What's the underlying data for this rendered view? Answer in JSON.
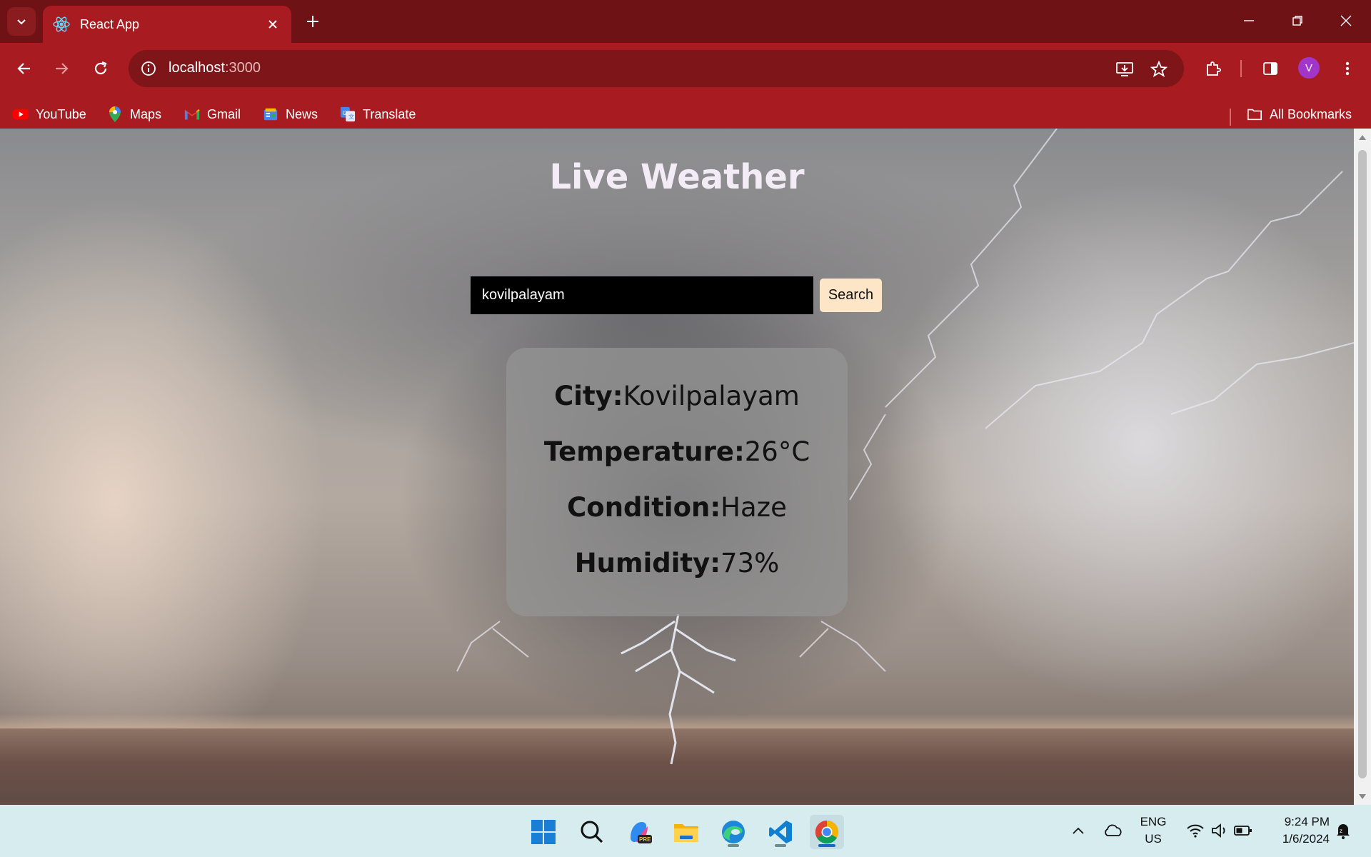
{
  "browser": {
    "tab_title": "React App",
    "url_host": "localhost",
    "url_port": ":3000",
    "avatar_letter": "V",
    "bookmarks": [
      {
        "label": "YouTube",
        "icon": "youtube-icon"
      },
      {
        "label": "Maps",
        "icon": "maps-icon"
      },
      {
        "label": "Gmail",
        "icon": "gmail-icon"
      },
      {
        "label": "News",
        "icon": "news-icon"
      },
      {
        "label": "Translate",
        "icon": "translate-icon"
      }
    ],
    "all_bookmarks_label": "All Bookmarks",
    "theme_color": "#a81b20"
  },
  "page": {
    "title": "Live Weather",
    "search": {
      "value": "kovilpalayam",
      "button_label": "Search"
    },
    "weather": {
      "city_label": "City:",
      "city_value": "Kovilpalayam",
      "temp_label": "Temperature:",
      "temp_value": "26°C",
      "condition_label": "Condition:",
      "condition_value": "Haze",
      "humidity_label": "Humidity:",
      "humidity_value": "73%"
    }
  },
  "taskbar": {
    "apps": [
      "start-icon",
      "search-icon",
      "copilot-icon",
      "file-explorer-icon",
      "edge-icon",
      "vscode-icon",
      "chrome-icon"
    ],
    "lang_line1": "ENG",
    "lang_line2": "US",
    "time": "9:24 PM",
    "date": "1/6/2024"
  }
}
